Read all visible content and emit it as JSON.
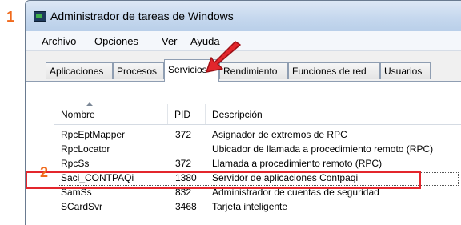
{
  "annotations": {
    "step1": "1",
    "step2": "2",
    "accent_color": "#e3262c",
    "step_color": "#f06a1c"
  },
  "window": {
    "title": "Administrador de tareas de Windows",
    "icon": "task-manager-icon"
  },
  "menu": [
    {
      "label": "Archivo"
    },
    {
      "label": "Opciones"
    },
    {
      "label": "Ver"
    },
    {
      "label": "Ayuda"
    }
  ],
  "tabs": [
    {
      "label": "Aplicaciones"
    },
    {
      "label": "Procesos"
    },
    {
      "label": "Servicios",
      "active": true
    },
    {
      "label": "Rendimiento"
    },
    {
      "label": "Funciones de red"
    },
    {
      "label": "Usuarios"
    }
  ],
  "table": {
    "headers": {
      "name": "Nombre",
      "pid": "PID",
      "desc": "Descripción"
    },
    "rows": [
      {
        "name": "RpcEptMapper",
        "pid": "372",
        "desc": "Asignador de extremos de RPC"
      },
      {
        "name": "RpcLocator",
        "pid": "",
        "desc": "Ubicador de llamada a procedimiento remoto (RPC)"
      },
      {
        "name": "RpcSs",
        "pid": "372",
        "desc": "Llamada a procedimiento remoto (RPC)"
      },
      {
        "name": "Saci_CONTPAQi",
        "pid": "1380",
        "desc": "Servidor de aplicaciones Contpaqi"
      },
      {
        "name": "SamSs",
        "pid": "832",
        "desc": "Administrador de cuentas de seguridad"
      },
      {
        "name": "SCardSvr",
        "pid": "3468",
        "desc": "Tarjeta inteligente"
      }
    ]
  }
}
